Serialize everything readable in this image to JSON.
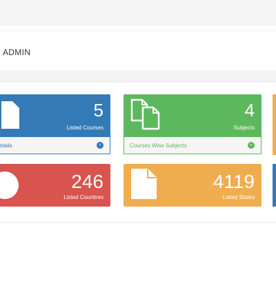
{
  "header": {
    "welcome": "ADMIN"
  },
  "tiles": {
    "courses": {
      "count": "5",
      "caption": "Listed Courses",
      "footer": "etails"
    },
    "subjects": {
      "count": "4",
      "caption": "Subjects",
      "footer": "Courses Wise Subjects"
    },
    "countries": {
      "count": "246",
      "caption": "Listed Countires"
    },
    "states": {
      "count": "4119",
      "caption": "Listed States"
    }
  },
  "colors": {
    "primary": "#337ab7",
    "success": "#5cb85c",
    "danger": "#d9534f",
    "warning": "#f0ad4e"
  },
  "icons": {
    "courses": "file-icon",
    "subjects": "files-icon",
    "countries": "globe-icon",
    "states": "file-icon",
    "footer_arrow": "circle-arrow-right-icon"
  }
}
